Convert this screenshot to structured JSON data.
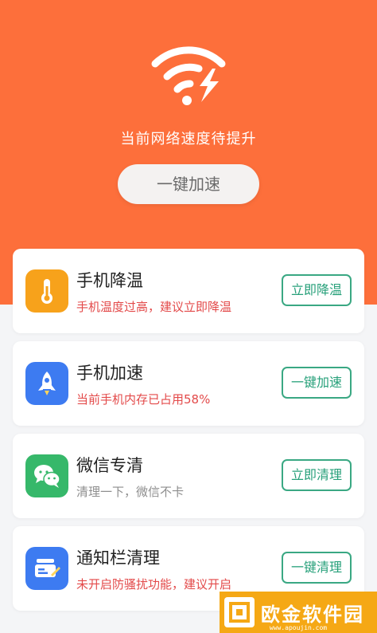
{
  "hero": {
    "status_text": "当前网络速度待提升",
    "boost_button_label": "一键加速",
    "icon": "wifi-lightning-icon"
  },
  "cards": [
    {
      "title": "手机降温",
      "subtitle": "手机温度过高，建议立即降温",
      "button": "立即降温",
      "icon": "thermometer-icon",
      "icon_color": "#f7a21b",
      "subtitle_color": "#e34a4a"
    },
    {
      "title": "手机加速",
      "subtitle": "当前手机内存已占用58%",
      "button": "一键加速",
      "icon": "rocket-icon",
      "icon_color": "#3d7bf1",
      "subtitle_color": "#e34a4a"
    },
    {
      "title": "微信专清",
      "subtitle": "清理一下，微信不卡",
      "button": "立即清理",
      "icon": "wechat-icon",
      "icon_color": "#36b86a",
      "subtitle_color": "#8e8e8e"
    },
    {
      "title": "通知栏清理",
      "subtitle": "未开启防骚扰功能，建议开启",
      "button": "一键清理",
      "icon": "notification-clean-icon",
      "icon_color": "#3d7bf1",
      "subtitle_color": "#e34a4a"
    }
  ],
  "watermark": {
    "text": "欧金软件园",
    "url": "www.apoujin.com"
  },
  "colors": {
    "header": "#fd6f3b",
    "button_accent": "#3aa883",
    "watermark": "#f5a815"
  }
}
